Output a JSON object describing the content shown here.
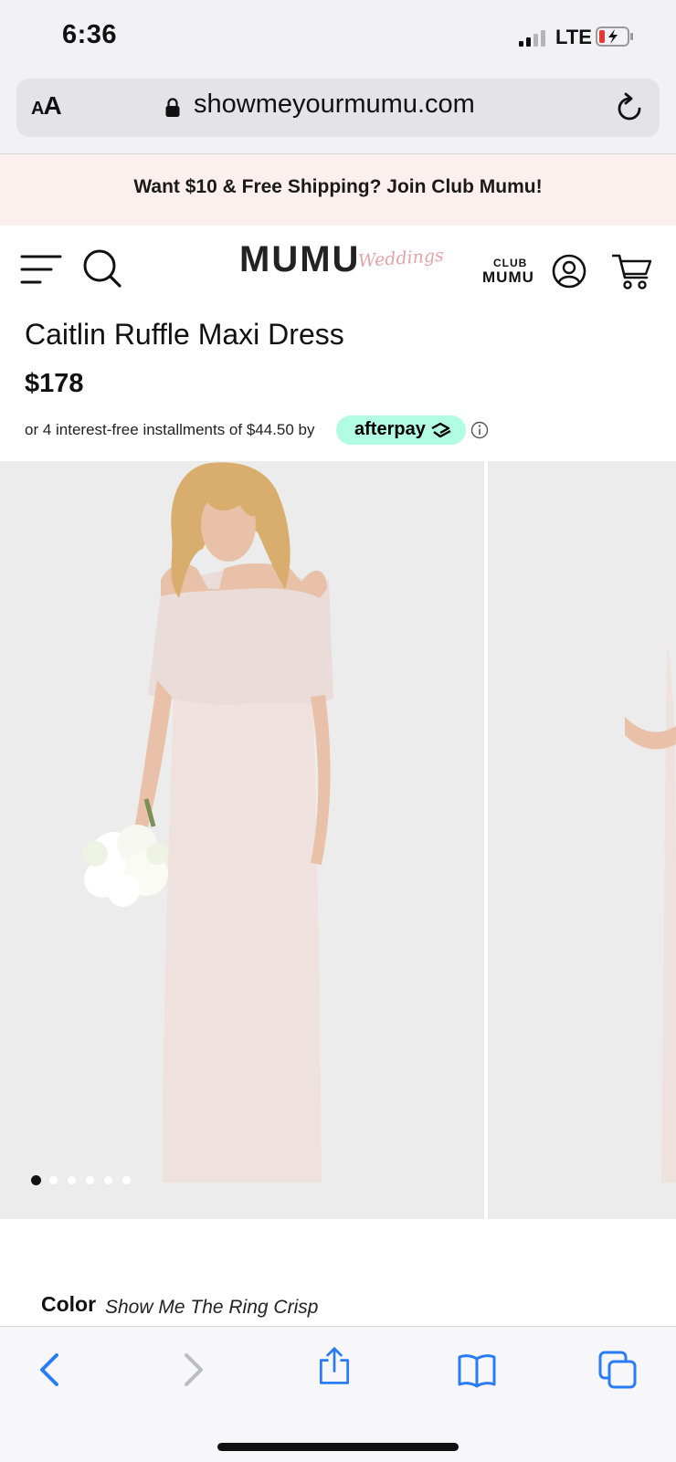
{
  "status_bar": {
    "time": "6:36",
    "carrier": "LTE"
  },
  "browser": {
    "text_size_label_small": "A",
    "text_size_label_large": "A",
    "url": "showmeyourmumu.com"
  },
  "promo": {
    "text": "Want $10 & Free Shipping? Join Club Mumu!"
  },
  "header": {
    "logo": "MUMU",
    "logo_script": "Weddings",
    "club_small": "CLUB",
    "club_large": "MUMU"
  },
  "product": {
    "title": "Caitlin Ruffle Maxi Dress",
    "price": "$178",
    "installments": "or 4 interest-free installments of $44.50 by",
    "afterpay": "afterpay"
  },
  "gallery": {
    "slide_count": 6,
    "active_index": 0
  },
  "color": {
    "label": "Color",
    "value": "Show Me The Ring Crisp"
  },
  "colors": {
    "afterpay_mint": "#b2fce4",
    "ios_blue": "#2a7bf6",
    "banner_pink": "#fbf0ee"
  },
  "toolbar": {
    "icons": [
      "back-icon",
      "forward-icon",
      "share-icon",
      "bookmarks-icon",
      "tabs-icon"
    ]
  }
}
